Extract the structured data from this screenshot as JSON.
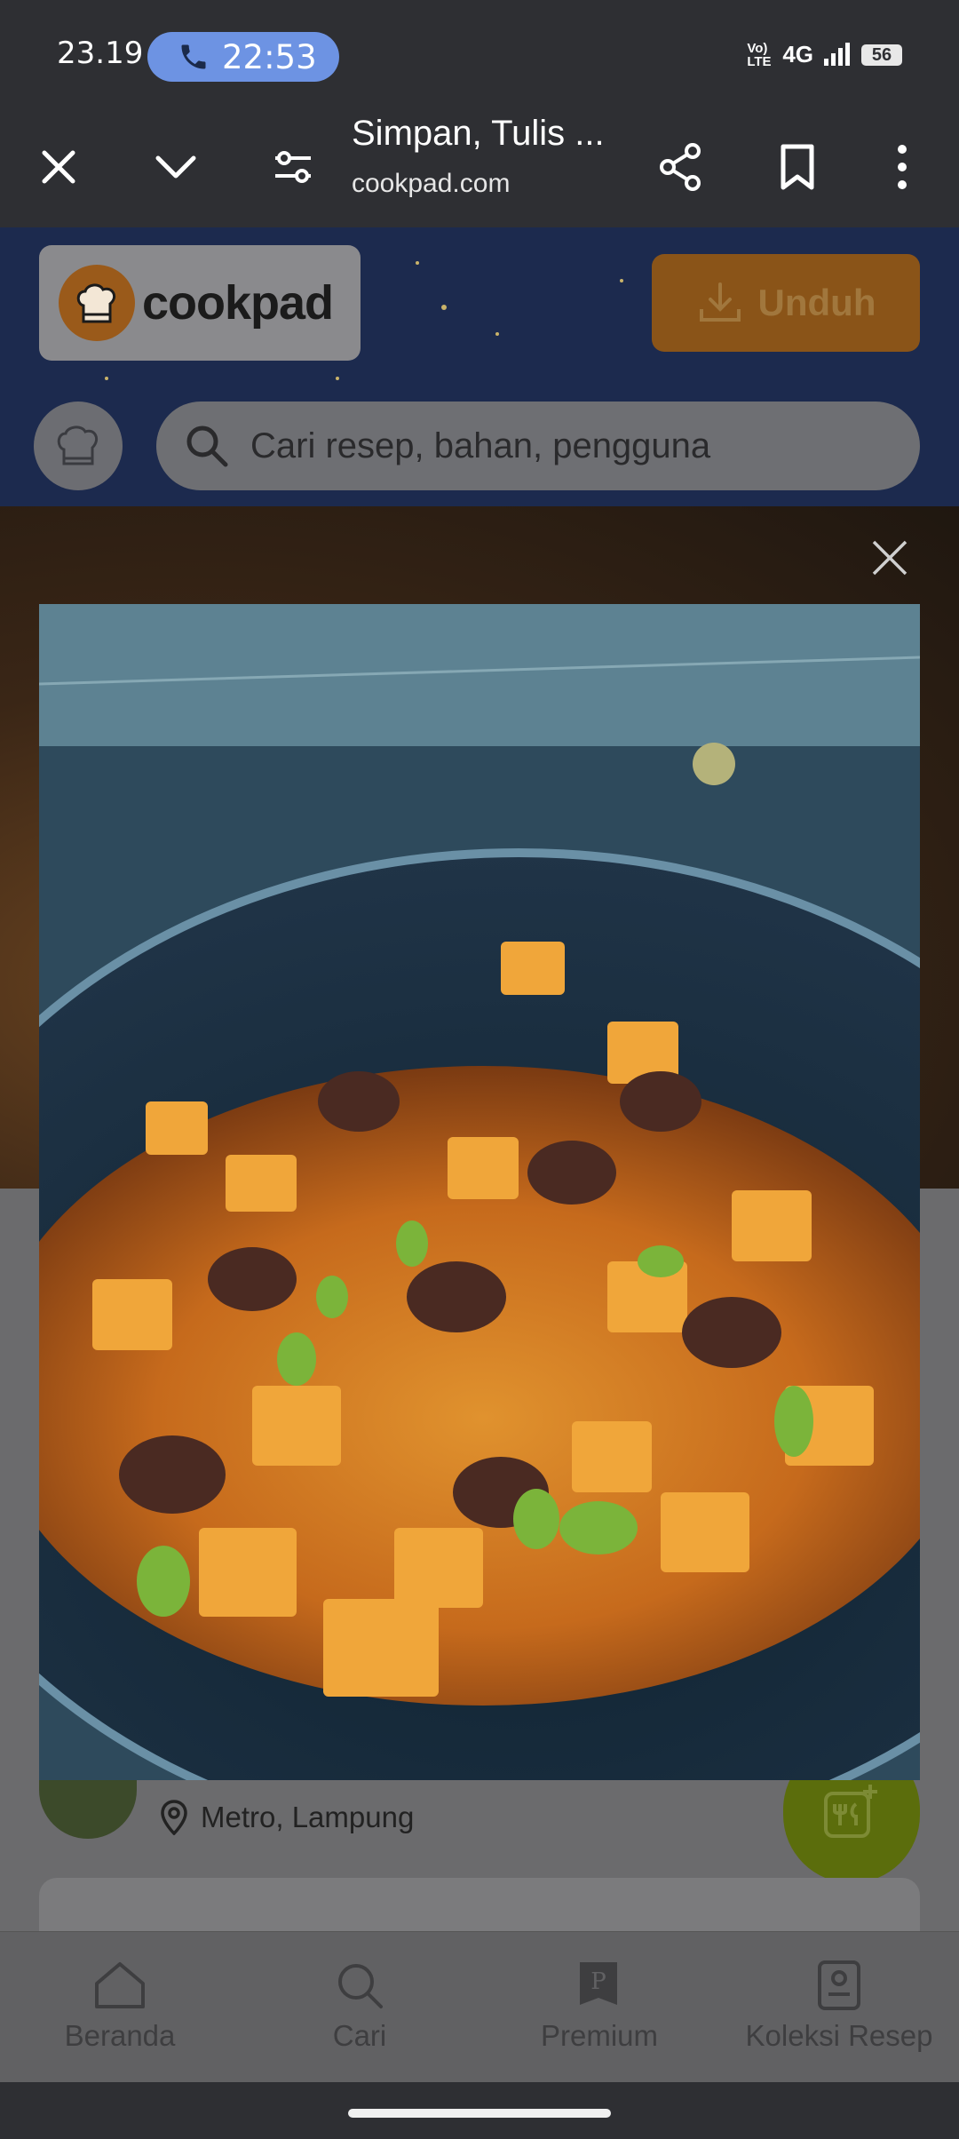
{
  "status_bar": {
    "time": "23.19",
    "call_time": "22:53",
    "network_volte": "Vo) LTE",
    "network_type": "4G",
    "battery": "56"
  },
  "browser": {
    "page_title": "Simpan, Tulis ...",
    "page_url": "cookpad.com"
  },
  "site": {
    "logo_text": "cookpad",
    "download_label": "Unduh",
    "search_placeholder": "Cari resep, bahan, pengguna"
  },
  "recipe": {
    "location": "Metro, Lampung"
  },
  "bottom_nav": {
    "items": [
      {
        "label": "Beranda",
        "icon": "home-icon"
      },
      {
        "label": "Cari",
        "icon": "search-icon"
      },
      {
        "label": "Premium",
        "icon": "premium-icon"
      },
      {
        "label": "Koleksi Resep",
        "icon": "recipe-collection-icon"
      }
    ]
  },
  "colors": {
    "status_bar_bg": "#2e2f33",
    "call_pill": "#6d93e3",
    "header_bg": "#1c2a4e",
    "download_button": "#8a5418",
    "fab": "#5b6d0c"
  }
}
